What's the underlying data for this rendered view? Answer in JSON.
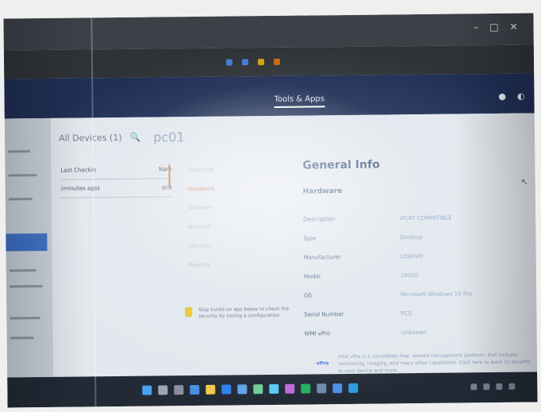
{
  "appbar": {
    "tabs": [
      "Tools & Apps"
    ]
  },
  "main": {
    "header": {
      "all_devices": "All Devices (1)",
      "device_name": "pc01"
    },
    "list": {
      "col_last_checkin": "Last Checkin",
      "col_name": "Nam",
      "row_time": "(minutes ago)",
      "row_name": "pc0"
    },
    "left_nav": {
      "items": [
        "Overview",
        "Hardware",
        "Software",
        "Network",
        "Security",
        "Reports"
      ]
    },
    "tip": {
      "text": "Stay tuned on app below to check the security by saving a configuration."
    }
  },
  "info": {
    "title": "General Info",
    "section": "Hardware",
    "rows": [
      {
        "label": "Description",
        "value": "AT/AT COMPATIBLE"
      },
      {
        "label": "Type",
        "value": "Desktop"
      },
      {
        "label": "Manufacturer",
        "value": "LENOVO"
      },
      {
        "label": "Model",
        "value": "10SK0"
      },
      {
        "label": "OS",
        "value": "Microsoft Windows 10 Pro"
      },
      {
        "label": "Serial Number",
        "value": "PC0"
      },
      {
        "label": "WMI vPro",
        "value": "Unknown"
      }
    ],
    "learn_badge": "vPro",
    "learn_text": "Intel vPro is a completely free, remote management platform, that includes monitoring, imaging, and many other capabilities. Click here to learn its benefits to your device and more."
  }
}
